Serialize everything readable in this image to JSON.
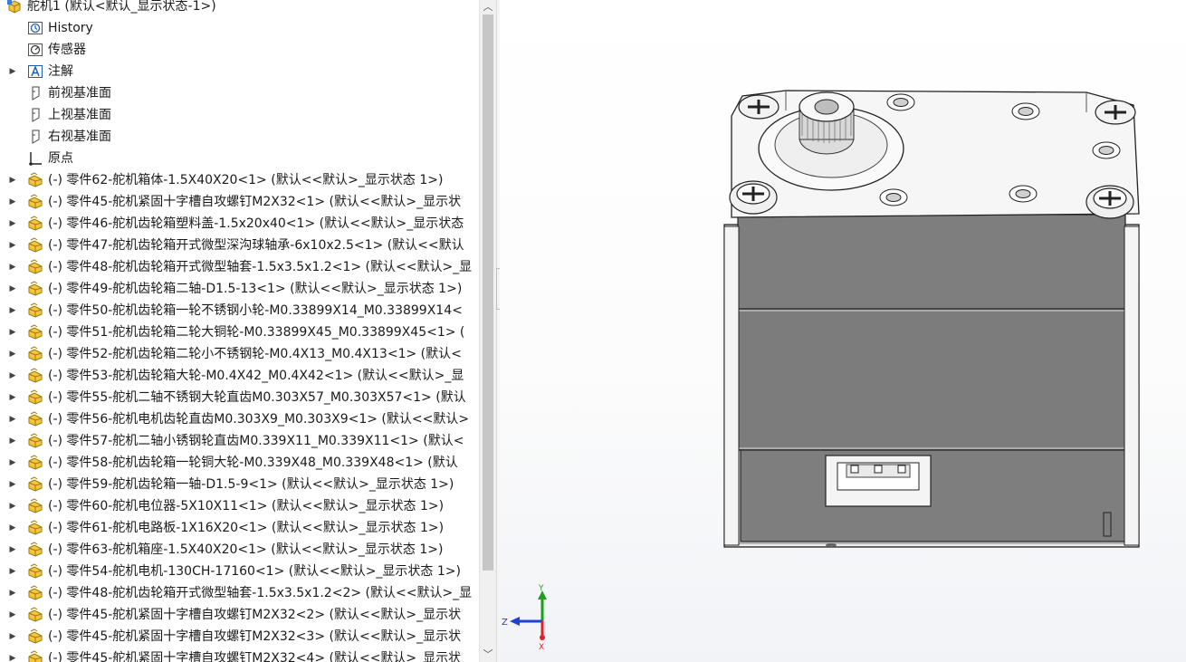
{
  "feature_tree": {
    "root_label": "舵机1  (默认<默认_显示状态-1>)",
    "items": [
      {
        "label": "History",
        "icon": "history-icon"
      },
      {
        "label": "传感器",
        "icon": "sensor-icon"
      },
      {
        "label": "注解",
        "icon": "annotation-icon"
      },
      {
        "label": "前视基准面",
        "icon": "plane-icon"
      },
      {
        "label": "上视基准面",
        "icon": "plane-icon"
      },
      {
        "label": "右视基准面",
        "icon": "plane-icon"
      },
      {
        "label": "原点",
        "icon": "origin-icon"
      }
    ],
    "parts": [
      "(-) 零件62-舵机箱体-1.5X40X20<1> (默认<<默认>_显示状态 1>)",
      "(-) 零件45-舵机紧固十字槽自攻螺钉M2X32<1> (默认<<默认>_显示状",
      "(-) 零件46-舵机齿轮箱塑料盖-1.5x20x40<1> (默认<<默认>_显示状态",
      "(-) 零件47-舵机齿轮箱开式微型深沟球轴承-6x10x2.5<1> (默认<<默认",
      "(-) 零件48-舵机齿轮箱开式微型轴套-1.5x3.5x1.2<1> (默认<<默认>_显",
      "(-) 零件49-舵机齿轮箱二轴-D1.5-13<1> (默认<<默认>_显示状态 1>)",
      "(-) 零件50-舵机齿轮箱一轮不锈钢小轮-M0.33899X14_M0.33899X14<",
      "(-) 零件51-舵机齿轮箱二轮大铜轮-M0.33899X45_M0.33899X45<1> (",
      "(-) 零件52-舵机齿轮箱二轮小不锈钢轮-M0.4X13_M0.4X13<1> (默认<",
      "(-) 零件53-舵机齿轮箱大轮-M0.4X42_M0.4X42<1> (默认<<默认>_显",
      "(-) 零件55-舵机二轴不锈钢大轮直齿M0.303X57_M0.303X57<1> (默认",
      "(-) 零件56-舵机电机齿轮直齿M0.303X9_M0.303X9<1> (默认<<默认>",
      "(-) 零件57-舵机二轴小锈钢轮直齿M0.339X11_M0.339X11<1> (默认<",
      "(-) 零件58-舵机齿轮箱一轮铜大轮-M0.339X48_M0.339X48<1> (默认",
      "(-) 零件59-舵机齿轮箱一轴-D1.5-9<1> (默认<<默认>_显示状态 1>)",
      "(-) 零件60-舵机电位器-5X10X11<1> (默认<<默认>_显示状态 1>)",
      "(-) 零件61-舵机电路板-1X16X20<1> (默认<<默认>_显示状态 1>)",
      "(-) 零件63-舵机箱座-1.5X40X20<1> (默认<<默认>_显示状态 1>)",
      "(-) 零件54-舵机电机-130CH-17160<1> (默认<<默认>_显示状态 1>)",
      "(-) 零件48-舵机齿轮箱开式微型轴套-1.5x3.5x1.2<2> (默认<<默认>_显",
      "(-) 零件45-舵机紧固十字槽自攻螺钉M2X32<2> (默认<<默认>_显示状",
      "(-) 零件45-舵机紧固十字槽自攻螺钉M2X32<3> (默认<<默认>_显示状",
      "(-) 零件45-舵机紧固十字槽自攻螺钉M2X32<4> (默认<<默认>_显示状"
    ]
  },
  "triad": {
    "x_label": "X",
    "y_label": "Y",
    "z_label": "Z"
  },
  "colors": {
    "part_icon": "#f4c53d",
    "model_body": "#7e7e7e",
    "model_top": "#f5f5f5",
    "triad_x": "#e0202a",
    "triad_y": "#1aa31a",
    "triad_z": "#1f3fd6"
  }
}
